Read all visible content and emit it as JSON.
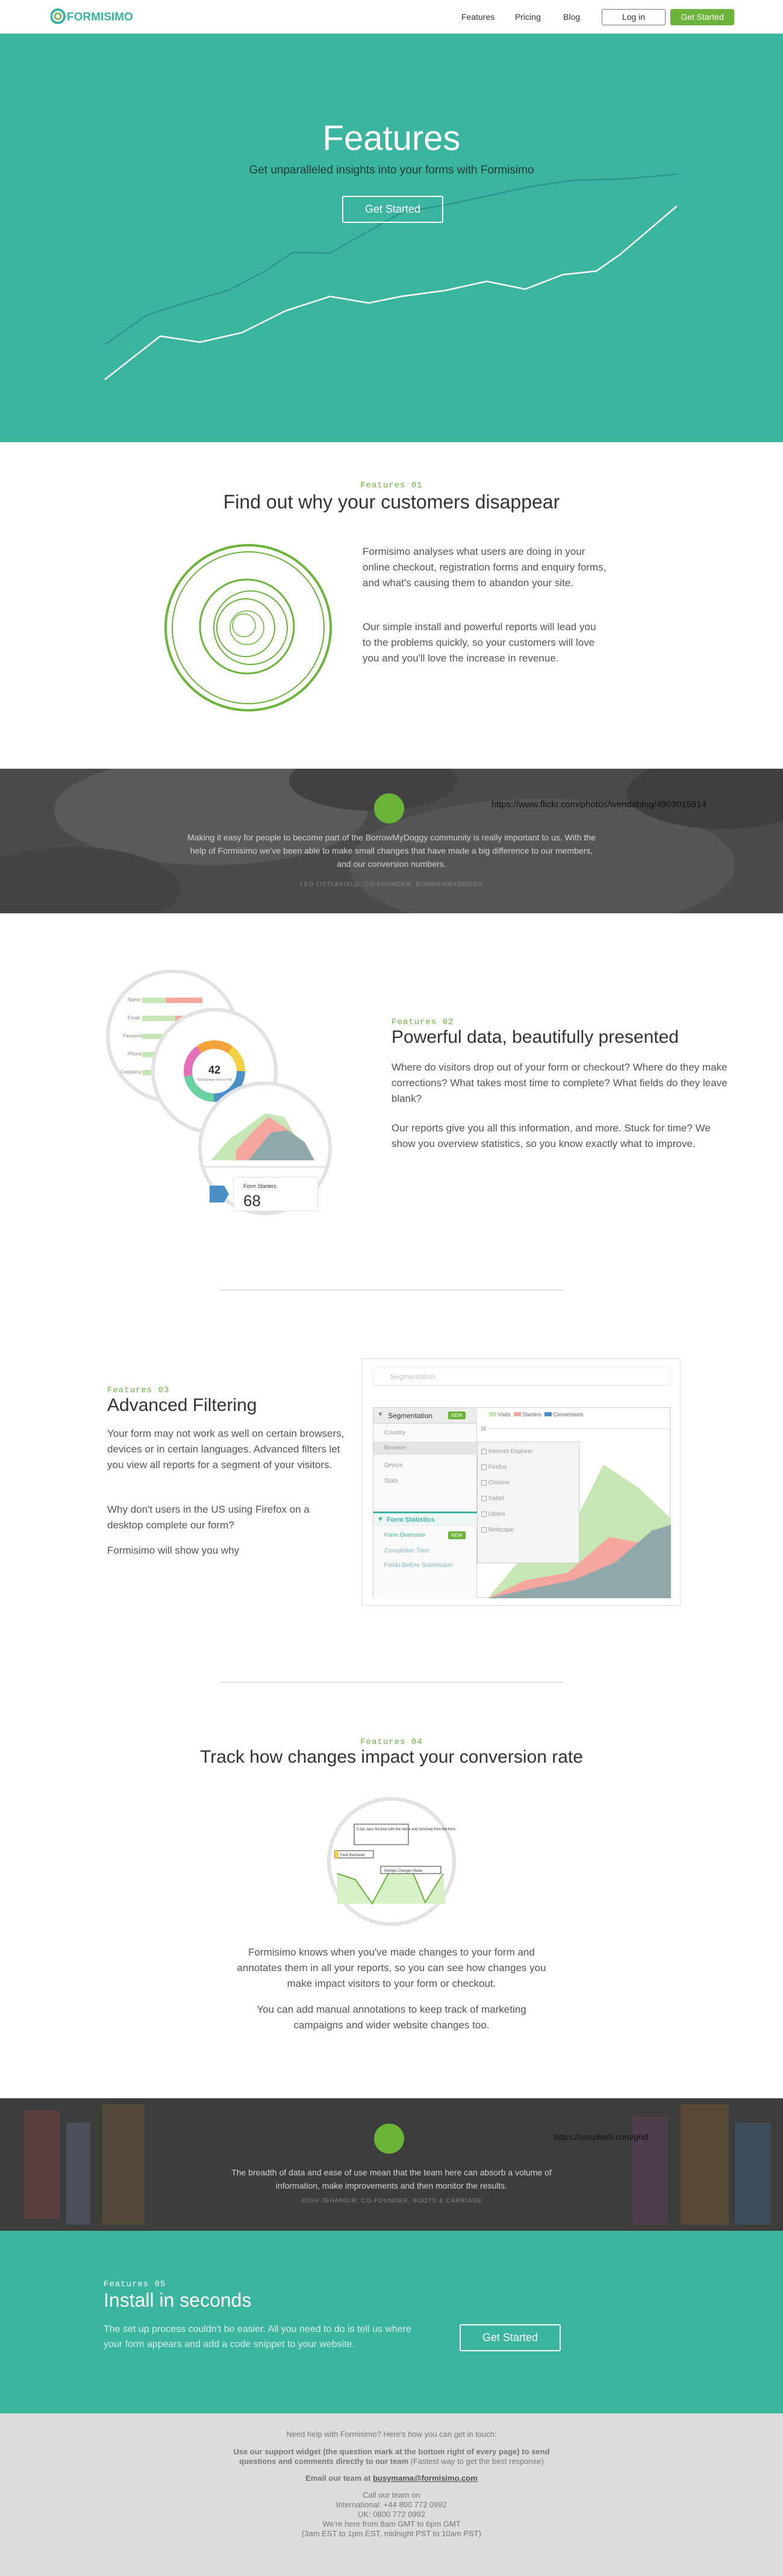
{
  "header": {
    "logo_text": "FORMISIMO",
    "nav": [
      "Features",
      "Pricing",
      "Blog"
    ],
    "login_label": "Log in",
    "cta_label": "Get Started"
  },
  "hero": {
    "title": "Features",
    "subtitle": "Get unparalleled insights into your forms with Formisimo",
    "cta_label": "Get Started"
  },
  "feature1": {
    "eyebrow": "Features 01",
    "title": "Find out why your customers disappear",
    "p1": "Formisimo analyses what users are doing in your online checkout, registration forms and enquiry forms, and what's causing them to abandon your site.",
    "p2": "Our simple install and powerful reports will lead you to the problems quickly, so your customers will love you and you'll love the increase in revenue."
  },
  "quote1": {
    "photo_url": "https://www.flickr.com/photos/wendablog/4903015914",
    "text": "Making it easy for people to become part of the BorrowMyDoggy community is really important to us. With the help of Formisimo we've been able to make small changes that have made a big difference to our members, and our conversion numbers.",
    "attribution": "LEO LITTLEFIELD, CO-FOUNDER, BORROWMYDOGGY"
  },
  "feature2": {
    "eyebrow": "Features 02",
    "title": "Powerful data, beautifully presented",
    "p1": "Where do visitors drop out of your form or checkout? Where do they make corrections? What takes most time to complete? What fields do they leave blank?",
    "p2": "Our reports give you all this information, and more. Stuck for time? We show you overview statistics, so you know exactly what to improve.",
    "donut_value": "42",
    "donut_caption": "Total Number of Form Fills",
    "bars_labels": [
      "Name",
      "Email",
      "Password",
      "Phone",
      "Company"
    ],
    "card_label": "Form Starters",
    "card_value": "68"
  },
  "feature3": {
    "eyebrow": "Features 03",
    "title": "Advanced Filtering",
    "p1": "Your form may not work as well on certain browsers, devices or in certain languages. Advanced filters let you view all reports for a segment of your visitors.",
    "p2": "Why don't users in the US using Firefox on a desktop complete our form?",
    "p3": "Formisimo will show you why",
    "panel": {
      "segmentation": "Segmentation",
      "badge": "NEW",
      "items": [
        "Country",
        "Browser",
        "Device",
        "Stats"
      ],
      "browsers": [
        "Internet Explorer",
        "Firefox",
        "Chrome",
        "Safari",
        "Opera",
        "Netscape"
      ],
      "legend": [
        "Visits",
        "Starters",
        "Conversions"
      ],
      "stats_title": "Form Statistics",
      "stats_items": [
        "Form Overview",
        "Completion Time",
        "Fields Before Submission"
      ],
      "axis_top": "15",
      "axis_mid": "5",
      "ghost_top": "Segmentation"
    }
  },
  "feature4": {
    "eyebrow": "Features 04",
    "title": "Track how changes impact your conversion rate",
    "p1": "Formisimo knows when you've made changes to your form and annotates them in all your reports, so you can see how changes you make impact visitors to your form or checkout.",
    "p2": "You can add manual annotations to keep track of marketing campaigns and wider website changes too.",
    "note1": "5 Apr\nJaco finished with the name and removed from the form.",
    "note2": "Field Removed",
    "note3": "Multiple Changes Made"
  },
  "quote2": {
    "photo_url": "https://unsplash.com/grid",
    "text": "The breadth of data and ease of use mean that the team here can absorb a volume of information, make improvements and then monitor the results.",
    "attribution": "JOSH JEHANGIR, CO-FOUNDER, BOOTS & CARRIAGE"
  },
  "install": {
    "eyebrow": "Features 05",
    "title": "Install in seconds",
    "text": "The set up process couldn't be easier. All you need to do is tell us where your form appears and add a code snippet to your website.",
    "cta_label": "Get Started"
  },
  "footer": {
    "line1": "Need help with Formisimo? Here's how you can get in touch:",
    "line2": "Use our support widget (the question mark at the bottom right of every page) to send",
    "line3a": "questions and comments directly to our team",
    "line3b": " (Fastest way to get the best response)",
    "line4a": "Email our team at ",
    "line4b": "busymama@formisimo.com",
    "line5": "Call our team on",
    "line6": "International: +44 800 772 0992",
    "line7": "UK: 0800 772 0992",
    "line8": "We're here from 8am GMT to 6pm GMT",
    "line9": "(3am EST to 1pm EST, midnight PST to 10am PST)"
  },
  "colors": {
    "teal": "#3bb59f",
    "green": "#6ab43a",
    "dark": "#4b4b4b"
  }
}
